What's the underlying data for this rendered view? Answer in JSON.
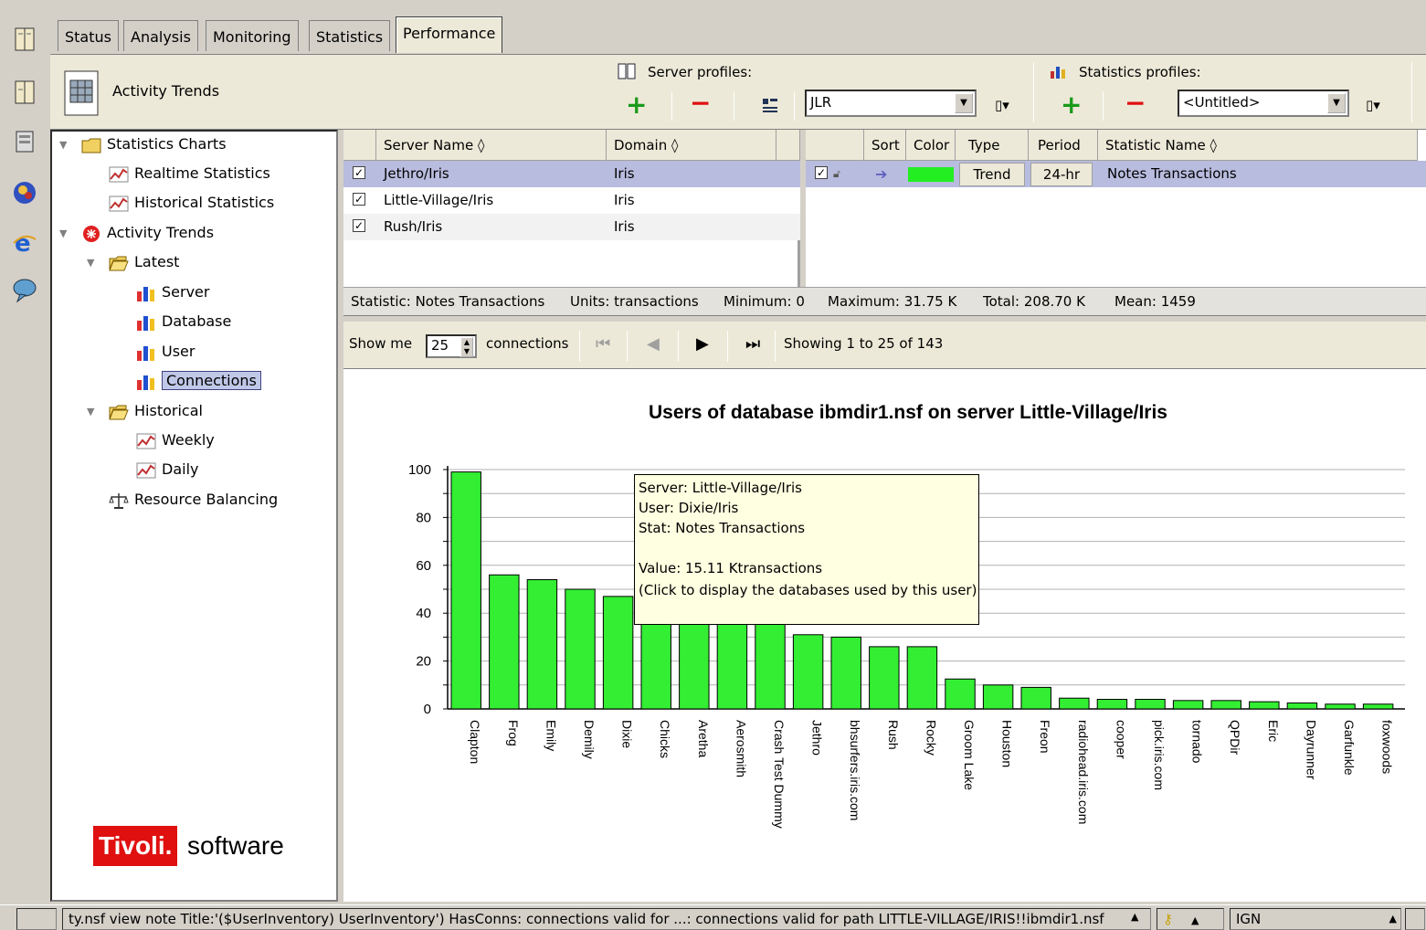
{
  "tabs": [
    "Status",
    "Analysis",
    "Monitoring",
    "Statistics",
    "Performance"
  ],
  "active_tab": "Performance",
  "toolbar": {
    "section_title": "Activity Trends",
    "server_profiles_label": "Server profiles:",
    "server_profile_value": "JLR",
    "statistics_profiles_label": "Statistics profiles:",
    "statistics_profile_value": "<Untitled>"
  },
  "nav": {
    "items": [
      {
        "label": "Statistics Charts"
      },
      {
        "label": "Realtime Statistics"
      },
      {
        "label": "Historical Statistics"
      },
      {
        "label": "Activity Trends"
      },
      {
        "label": "Latest"
      },
      {
        "label": "Server"
      },
      {
        "label": "Database"
      },
      {
        "label": "User"
      },
      {
        "label": "Connections"
      },
      {
        "label": "Historical"
      },
      {
        "label": "Weekly"
      },
      {
        "label": "Daily"
      },
      {
        "label": "Resource Balancing"
      }
    ],
    "logo_brand": "Tivoli.",
    "logo_suffix": "software"
  },
  "server_table": {
    "headers": [
      "Server Name ◊",
      "Domain ◊"
    ],
    "rows": [
      {
        "name": "Jethro/Iris",
        "domain": "Iris",
        "checked": true
      },
      {
        "name": "Little-Village/Iris",
        "domain": "Iris",
        "checked": true
      },
      {
        "name": "Rush/Iris",
        "domain": "Iris",
        "checked": true
      }
    ]
  },
  "stat_table": {
    "headers": [
      "Sort",
      "Color",
      "Type",
      "Period",
      "Statistic Name ◊"
    ],
    "row": {
      "type": "Trend",
      "period": "24-hr",
      "name": "Notes Transactions",
      "color": "#22ee22"
    }
  },
  "stat_summary": {
    "statistic": "Statistic: Notes Transactions",
    "units": "Units: transactions",
    "minimum": "Minimum: 0",
    "maximum": "Maximum: 31.75 K",
    "total": "Total: 208.70 K",
    "mean": "Mean: 1459"
  },
  "pager": {
    "show_me": "Show me",
    "count": "25",
    "connections": "connections",
    "showing": "Showing 1 to 25 of 143"
  },
  "tooltip": {
    "server": "Server: Little-Village/Iris",
    "user": "User: Dixie/Iris",
    "stat": "Stat: Notes Transactions",
    "value": "Value: 15.11 Ktransactions",
    "hint": "(Click to display the databases used by this user)"
  },
  "statusbar": {
    "message": "ty.nsf view note Title:'($UserInventory) UserInventory') HasConns: connections valid for ...: connections valid for path LITTLE-VILLAGE/IRIS!!ibmdir1.nsf",
    "location": "IGN"
  },
  "chart_data": {
    "type": "bar",
    "title": "Users of database ibmdir1.nsf on server Little-Village/Iris",
    "xlabel": "",
    "ylabel": "",
    "ylim": [
      0,
      100
    ],
    "yticks": [
      0,
      20,
      40,
      60,
      80,
      100
    ],
    "grid": true,
    "bar_color": "#33ee33",
    "categories": [
      "Clapton",
      "Frog",
      "Emily",
      "Demily",
      "Dixie",
      "Chicks",
      "Aretha",
      "Aerosmith",
      "Crash Test Dummy",
      "Jethro",
      "bhsurfers.iris.com",
      "Rush",
      "Rocky",
      "Groom Lake",
      "Houston",
      "Freon",
      "radiohead.iris.com",
      "cooper",
      "pick.iris.com",
      "tornado",
      "QPDir",
      "Eric",
      "Dayrunner",
      "Garfunkle",
      "foxwoods"
    ],
    "values": [
      99,
      56,
      54,
      50,
      47,
      41,
      41,
      40,
      40,
      31,
      30,
      26,
      26,
      12.5,
      10,
      9,
      4.5,
      4,
      4,
      3.5,
      3.5,
      3,
      2.5,
      2,
      2
    ]
  }
}
